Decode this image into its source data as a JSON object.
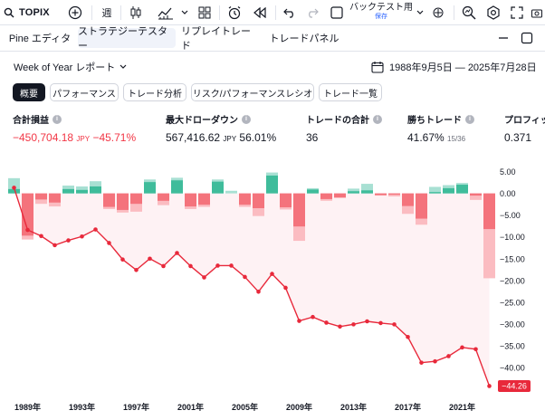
{
  "toolbar": {
    "symbol": "TOPIX",
    "interval": "週",
    "backtest_label": "バックテスト用",
    "backtest_status": "保存"
  },
  "tabs": [
    {
      "label": "Pine エディタ",
      "active": false
    },
    {
      "label": "ストラテジーテスター",
      "active": true
    },
    {
      "label": "リプレイトレード",
      "active": false
    },
    {
      "label": "トレードパネル",
      "active": false
    }
  ],
  "report": {
    "title": "Week of Year レポート",
    "date_range": "1988年9月5日 — 2025年7月28日"
  },
  "subtabs": [
    "概要",
    "パフォーマンス",
    "トレード分析",
    "リスク/パフォーマンスレシオ",
    "トレード一覧"
  ],
  "metrics": [
    {
      "label": "合計損益",
      "value": "−450,704.18",
      "unit": "JPY",
      "extra": "−45.71%",
      "negative": true
    },
    {
      "label": "最大ドローダウン",
      "value": "567,416.62",
      "unit": "JPY",
      "extra": "56.01%",
      "negative": false
    },
    {
      "label": "トレードの合計",
      "value": "36",
      "unit": "",
      "extra": "",
      "negative": false
    },
    {
      "label": "勝ちトレード",
      "value": "41.67%",
      "unit": "",
      "extra": "15/36",
      "negative": false
    },
    {
      "label": "プロフィッ",
      "value": "0.371",
      "unit": "",
      "extra": "",
      "negative": false
    }
  ],
  "colors": {
    "up_light": "#a8e0d3",
    "up_dark": "#3fbc9b",
    "down_light": "#fbbcc1",
    "down_dark": "#f4737c",
    "equity_line": "#e8293b",
    "area_fill": "#fdeef0",
    "active_tab_bg": "#f0f3fa",
    "accent": "#2962ff"
  },
  "chart_data": {
    "type": "line",
    "x_tick_labels": [
      "1989年",
      "1993年",
      "1997年",
      "2001年",
      "2005年",
      "2009年",
      "2013年",
      "2017年",
      "2021年"
    ],
    "y_ticks": [
      5.0,
      0.0,
      -5.0,
      -10.0,
      -15.0,
      -20.0,
      -25.0,
      -30.0,
      -35.0,
      -40.0
    ],
    "y_tick_labels": [
      "5.00",
      "0.00",
      "−5.00",
      "−10.00",
      "−15.00",
      "−20.00",
      "−25.00",
      "−30.00",
      "−35.00",
      "−40.00"
    ],
    "ylim": [
      -45,
      7
    ],
    "last_value_label": "−44.26",
    "equity_percent": [
      1.3,
      -8.4,
      -9.8,
      -11.9,
      -10.8,
      -9.9,
      -8.3,
      -11.4,
      -15.2,
      -17.6,
      -15.0,
      -16.7,
      -13.7,
      -16.7,
      -19.3,
      -16.6,
      -16.6,
      -19.2,
      -22.6,
      -18.5,
      -21.7,
      -29.3,
      -28.4,
      -29.7,
      -30.6,
      -30.1,
      -29.4,
      -29.8,
      -30.1,
      -33.0,
      -38.9,
      -38.6,
      -37.4,
      -35.4,
      -35.8,
      -44.26
    ],
    "bars": [
      {
        "light": 3.5,
        "dark": 1.0
      },
      {
        "light": -10.6,
        "dark": -9.7
      },
      {
        "light": -2.4,
        "dark": -1.4
      },
      {
        "light": -3.0,
        "dark": -2.1
      },
      {
        "light": 1.8,
        "dark": 1.0
      },
      {
        "light": 1.6,
        "dark": 0.8
      },
      {
        "light": 2.8,
        "dark": 1.6
      },
      {
        "light": -3.6,
        "dark": -3.1
      },
      {
        "light": -4.4,
        "dark": -3.8
      },
      {
        "light": -4.2,
        "dark": -2.4
      },
      {
        "light": 3.2,
        "dark": 2.6
      },
      {
        "light": -2.7,
        "dark": -1.7
      },
      {
        "light": 3.6,
        "dark": 3.0
      },
      {
        "light": -3.6,
        "dark": -3.0
      },
      {
        "light": -3.1,
        "dark": -2.6
      },
      {
        "light": 3.2,
        "dark": 2.7
      },
      {
        "light": 0.6,
        "dark": 0.0
      },
      {
        "light": -3.1,
        "dark": -2.6
      },
      {
        "light": -5.2,
        "dark": -3.4
      },
      {
        "light": 4.8,
        "dark": 4.1
      },
      {
        "light": -3.7,
        "dark": -3.2
      },
      {
        "light": -10.9,
        "dark": -7.6
      },
      {
        "light": 1.2,
        "dark": 0.9
      },
      {
        "light": -1.7,
        "dark": -1.3
      },
      {
        "light": -1.1,
        "dark": -0.9
      },
      {
        "light": 1.1,
        "dark": 0.5
      },
      {
        "light": 2.2,
        "dark": 0.7
      },
      {
        "light": -0.5,
        "dark": -0.4
      },
      {
        "light": -0.7,
        "dark": -0.3
      },
      {
        "light": -4.7,
        "dark": -2.9
      },
      {
        "light": -7.2,
        "dark": -5.8
      },
      {
        "light": 1.5,
        "dark": 0.3
      },
      {
        "light": 1.9,
        "dark": 1.2
      },
      {
        "light": 2.4,
        "dark": 2.0
      },
      {
        "light": -1.5,
        "dark": -0.5
      },
      {
        "light": -19.5,
        "dark": -8.2
      }
    ],
    "grid": false
  }
}
